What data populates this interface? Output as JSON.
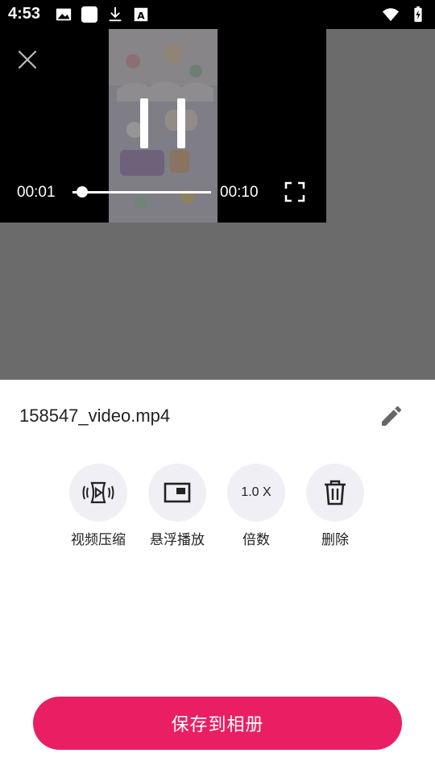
{
  "status_bar": {
    "time": "4:53",
    "left_icons": [
      "image-icon",
      "square-app-icon",
      "download-icon",
      "font-icon"
    ],
    "right_icons": [
      "wifi-icon",
      "battery-icon"
    ]
  },
  "player": {
    "current_time": "00:01",
    "total_time": "00:10",
    "progress": 0.07,
    "state": "playing"
  },
  "file": {
    "name": "158547_video.mp4"
  },
  "actions": [
    {
      "icon": "video-compress-icon",
      "label": "视频压缩"
    },
    {
      "icon": "picture-in-picture-icon",
      "label": "悬浮播放"
    },
    {
      "icon": "speed-text",
      "label": "倍数",
      "value": "1.0 X"
    },
    {
      "icon": "trash-icon",
      "label": "删除"
    }
  ],
  "save_button": {
    "label": "保存到相册"
  },
  "colors": {
    "accent": "#ea1f63",
    "action_bg": "#f0eff5",
    "backdrop": "#6b6b6b"
  }
}
